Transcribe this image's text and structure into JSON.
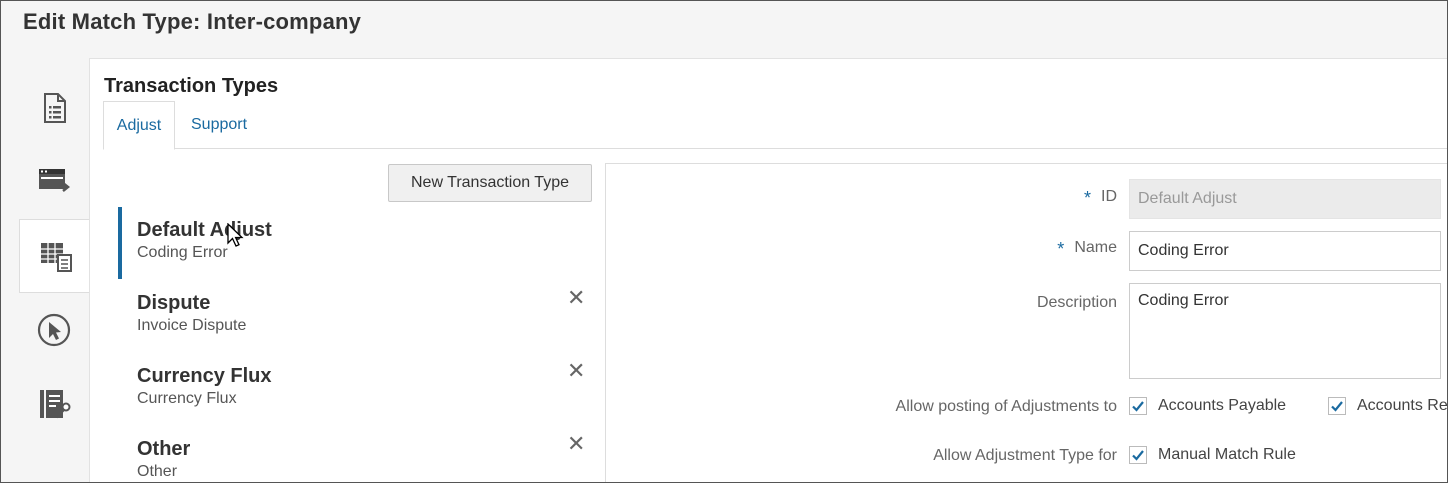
{
  "page": {
    "title": "Edit Match Type: Inter-company"
  },
  "sidebar": {
    "items": [
      {
        "icon": "document-list-icon"
      },
      {
        "icon": "window-transfer-icon"
      },
      {
        "icon": "table-document-icon",
        "active": true
      },
      {
        "icon": "pointer-circle-icon"
      },
      {
        "icon": "list-wrench-icon"
      }
    ]
  },
  "panel": {
    "title": "Transaction Types",
    "tabs": [
      {
        "label": "Adjust"
      },
      {
        "label": "Support"
      }
    ],
    "new_button_label": "New Transaction Type",
    "items": [
      {
        "title": "Default Adjust",
        "subtitle": "Coding Error"
      },
      {
        "title": "Dispute",
        "subtitle": "Invoice Dispute"
      },
      {
        "title": "Currency Flux",
        "subtitle": "Currency Flux"
      },
      {
        "title": "Other",
        "subtitle": "Other"
      }
    ],
    "delete_glyph": "✕"
  },
  "form": {
    "required_marker": "*",
    "id_label": "ID",
    "id_value": "Default Adjust",
    "name_label": "Name",
    "name_value": "Coding Error",
    "description_label": "Description",
    "description_value": "Coding Error",
    "posting_label": "Allow posting of Adjustments to",
    "posting_options": [
      {
        "label": "Accounts Payable",
        "checked": true
      },
      {
        "label": "Accounts Re",
        "checked": true
      }
    ],
    "adjustment_type_label": "Allow Adjustment Type for",
    "adjustment_type_options": [
      {
        "label": "Manual Match Rule",
        "checked": true
      }
    ]
  },
  "colors": {
    "accent": "#1a6aa0"
  }
}
